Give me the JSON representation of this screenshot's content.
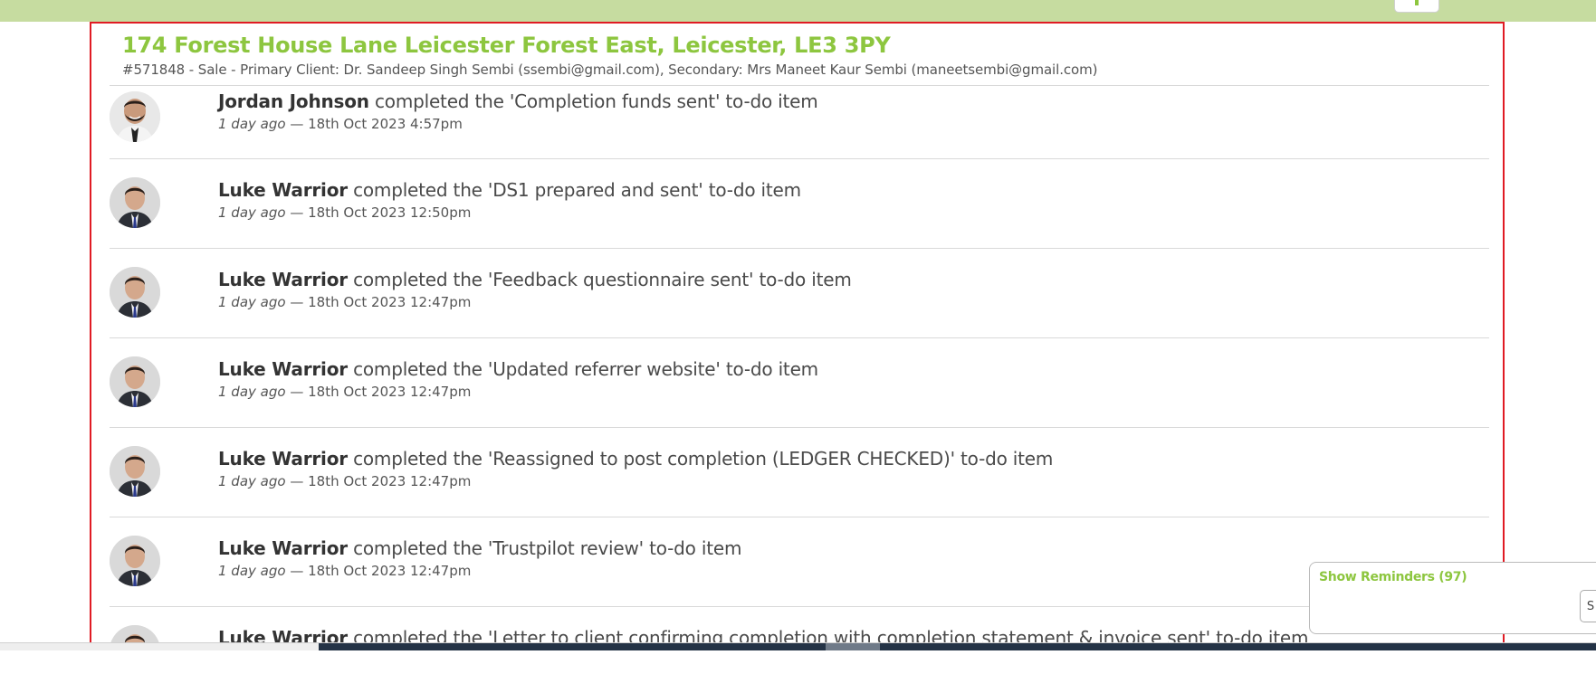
{
  "property": {
    "title": "174 Forest House Lane Leicester Forest East, Leicester, LE3 3PY",
    "subtitle": "#571848 - Sale - Primary Client: Dr. Sandeep Singh Sembi (ssembi@gmail.com), Secondary: Mrs Maneet Kaur Sembi (maneetsembi@gmail.com)"
  },
  "activities": [
    {
      "user": "Jordan Johnson",
      "action": "completed the 'Completion funds sent' to-do item",
      "ago": "1 day ago",
      "datetime": "— 18th Oct 2023 4:57pm",
      "avatar_icon": "user-avatar-bearded"
    },
    {
      "user": "Luke Warrior",
      "action": "completed the 'DS1 prepared and sent' to-do item",
      "ago": "1 day ago",
      "datetime": "— 18th Oct 2023 12:50pm",
      "avatar_icon": "user-avatar"
    },
    {
      "user": "Luke Warrior",
      "action": "completed the 'Feedback questionnaire sent' to-do item",
      "ago": "1 day ago",
      "datetime": "— 18th Oct 2023 12:47pm",
      "avatar_icon": "user-avatar"
    },
    {
      "user": "Luke Warrior",
      "action": "completed the 'Updated referrer website' to-do item",
      "ago": "1 day ago",
      "datetime": "— 18th Oct 2023 12:47pm",
      "avatar_icon": "user-avatar"
    },
    {
      "user": "Luke Warrior",
      "action": "completed the 'Reassigned to post completion (LEDGER CHECKED)' to-do item",
      "ago": "1 day ago",
      "datetime": "— 18th Oct 2023 12:47pm",
      "avatar_icon": "user-avatar"
    },
    {
      "user": "Luke Warrior",
      "action": "completed the 'Trustpilot review' to-do item",
      "ago": "1 day ago",
      "datetime": "— 18th Oct 2023 12:47pm",
      "avatar_icon": "user-avatar"
    },
    {
      "user": "Luke Warrior",
      "action": "completed the 'Letter to client confirming completion with completion statement & invoice sent' to-do item",
      "ago": "",
      "datetime": "",
      "avatar_icon": "user-avatar"
    }
  ],
  "reminders": {
    "label": "Show Reminders (97)",
    "button_label": "S"
  },
  "colors": {
    "accent": "#8dc63f",
    "top_bar": "#c6dca0",
    "highlight_border": "#e01b24"
  }
}
